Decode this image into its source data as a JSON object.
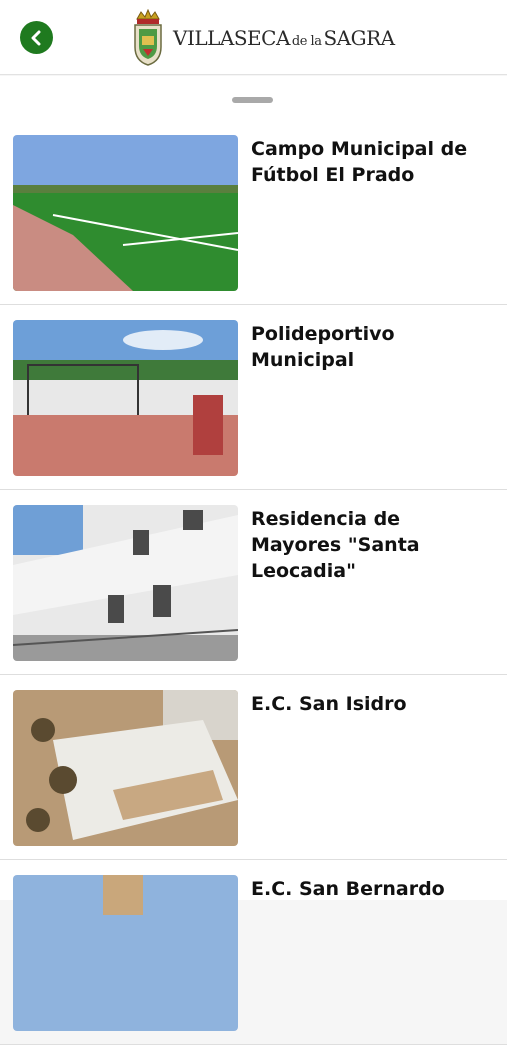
{
  "header": {
    "logo_text": {
      "main1": "VILLASECA",
      "mid": "de la",
      "main2": "SAGRA"
    }
  },
  "colors": {
    "accent": "#1f7a1f"
  },
  "items": [
    {
      "title": "Campo Municipal de Fútbol El Prado"
    },
    {
      "title": "Polideportivo Municipal"
    },
    {
      "title": "Residencia de Mayores \"Santa Leocadia\""
    },
    {
      "title": "E.C. San Isidro"
    },
    {
      "title": "E.C. San Bernardo"
    }
  ]
}
